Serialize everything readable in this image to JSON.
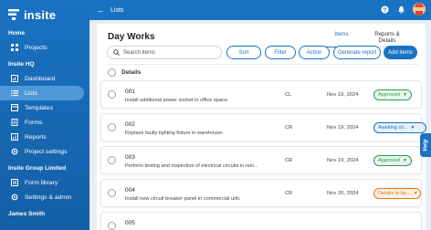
{
  "app": {
    "logo_text": "insite"
  },
  "sidebar": {
    "sections": [
      {
        "title": "Home",
        "items": [
          {
            "label": "Projects",
            "icon": "grid-icon"
          }
        ]
      },
      {
        "title": "Insite HQ",
        "items": [
          {
            "label": "Dashboard",
            "icon": "dashboard-icon"
          },
          {
            "label": "Lists",
            "icon": "list-icon",
            "active": true
          },
          {
            "label": "Templates",
            "icon": "template-icon"
          },
          {
            "label": "Forms",
            "icon": "form-icon"
          },
          {
            "label": "Reports",
            "icon": "report-icon"
          },
          {
            "label": "Project settings",
            "icon": "gear-icon"
          }
        ]
      },
      {
        "title": "Insite Group Limited",
        "items": [
          {
            "label": "Form library",
            "icon": "library-icon"
          },
          {
            "label": "Settings & admin",
            "icon": "gear-icon"
          }
        ]
      },
      {
        "title": "James Smith",
        "items": []
      }
    ]
  },
  "header": {
    "title": "Lists"
  },
  "main": {
    "title": "Day Works",
    "tabs": [
      {
        "label": "Items",
        "active": true
      },
      {
        "label": "Reports & Details",
        "active": false
      }
    ],
    "search_placeholder": "Search items",
    "buttons": {
      "sort": "Sort",
      "filter": "Filter",
      "action": "Action",
      "generate": "Generate report",
      "add": "Add items"
    },
    "list_header": "Details"
  },
  "rows": [
    {
      "num": "001",
      "desc": "Install additional power socket in office space.",
      "type": "CL",
      "date": "Nov 19, 2024",
      "status": "Approved",
      "status_color": "#2e9b4f",
      "status_bg": "#e7f6ec"
    },
    {
      "num": "002",
      "desc": "Replace faulty lighting fixture in warehouse.",
      "type": "CR",
      "date": "Nov 19, 2024",
      "status": "Awaiting cli...",
      "status_color": "#1a72c2",
      "status_bg": "#e6f0fb"
    },
    {
      "num": "003",
      "desc": "Perform testing and inspection of electrical circuits in resi...",
      "type": "CR",
      "date": "Nov 19, 2024",
      "status": "Approved",
      "status_color": "#2e9b4f",
      "status_bg": "#e7f6ec"
    },
    {
      "num": "004",
      "desc": "Install new circuit breaker panel in commercial unit.",
      "type": "CR",
      "date": "Nov 20, 2024",
      "status": "Details to be...",
      "status_color": "#e07b1a",
      "status_bg": "#fdf0e3"
    },
    {
      "num": "005",
      "desc": "",
      "type": "",
      "date": "",
      "status": "",
      "status_color": "#2e9b4f",
      "status_bg": "#ffffff"
    }
  ],
  "help": {
    "label": "Help"
  }
}
